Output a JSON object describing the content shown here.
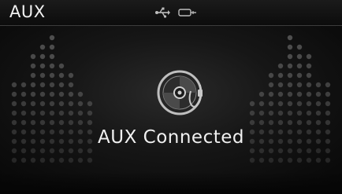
{
  "header": {
    "title": "AUX"
  },
  "status_icons": [
    "usb-icon",
    "aux-plug-icon"
  ],
  "main": {
    "icon": "aux-disc-icon",
    "message": "AUX Connected"
  },
  "colors": {
    "text": "#f2f2f2",
    "icon": "#bfbfbf",
    "background": "#141414"
  }
}
